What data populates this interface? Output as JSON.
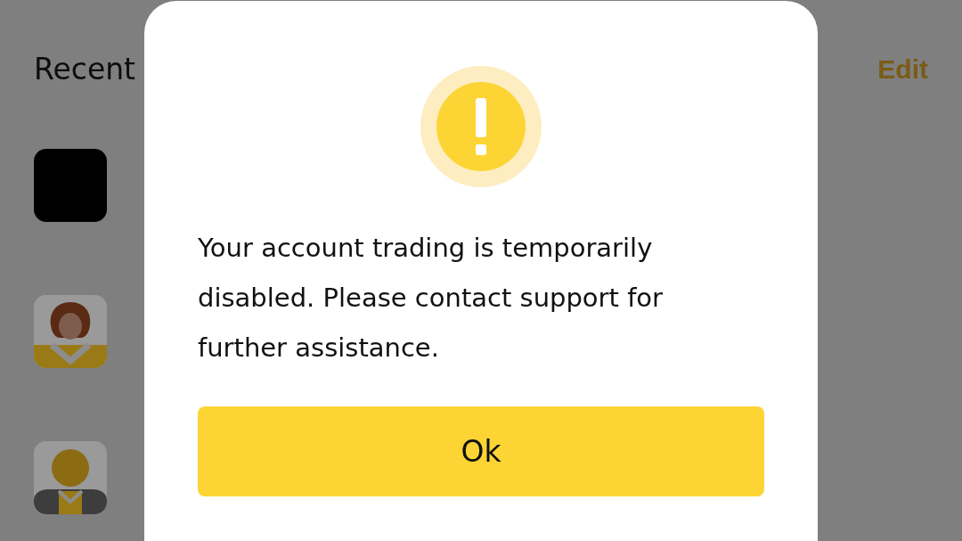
{
  "page": {
    "title": "Recent",
    "edit_link": "Edit",
    "items": [
      {
        "kind": "photo"
      },
      {
        "kind": "woman"
      },
      {
        "kind": "person"
      }
    ]
  },
  "dialog": {
    "message": "Your account trading is temporarily disabled. Please contact support for further assistance.",
    "button": "Ok"
  }
}
